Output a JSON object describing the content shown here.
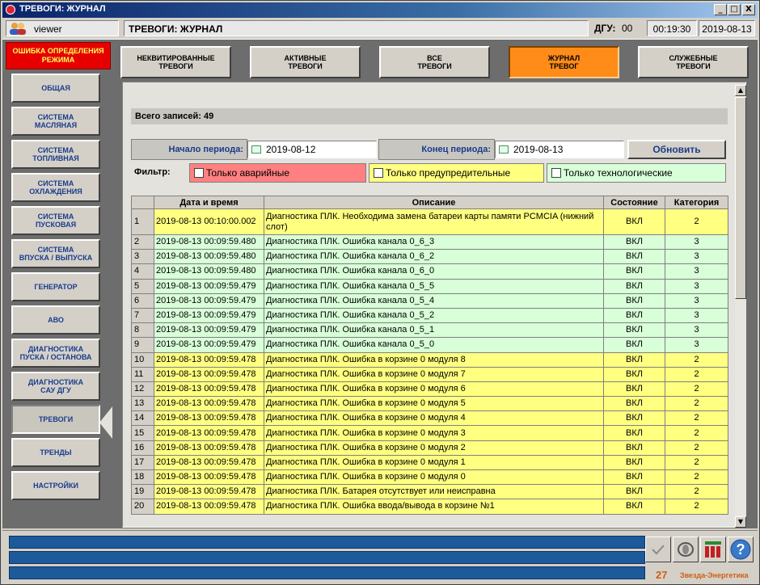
{
  "window": {
    "title": "ТРЕВОГИ: ЖУРНАЛ",
    "min": "_",
    "max": "□",
    "close": "X"
  },
  "infobar": {
    "user": "viewer",
    "screen_title": "ТРЕВОГИ: ЖУРНАЛ",
    "dgu_label": "ДГУ:",
    "dgu_value": "00",
    "time": "00:19:30",
    "date": "2019-08-13"
  },
  "sidebar": {
    "alarm": "ОШИБКА ОПРЕДЕЛЕНИЯ\nРЕЖИМА",
    "items": [
      {
        "label": "ОБЩАЯ"
      },
      {
        "label": "СИСТЕМА\nМАСЛЯНАЯ"
      },
      {
        "label": "СИСТЕМА\nТОПЛИВНАЯ"
      },
      {
        "label": "СИСТЕМА\nОХЛАЖДЕНИЯ"
      },
      {
        "label": "СИСТЕМА\nПУСКОВАЯ"
      },
      {
        "label": "СИСТЕМА\nВПУСКА / ВЫПУСКА"
      },
      {
        "label": "ГЕНЕРАТОР"
      },
      {
        "label": "АВО"
      },
      {
        "label": "ДИАГНОСТИКА\nПУСКА / ОСТАНОВА"
      },
      {
        "label": "ДИАГНОСТИКА\nСАУ ДГУ"
      },
      {
        "label": "ТРЕВОГИ"
      },
      {
        "label": "ТРЕНДЫ"
      },
      {
        "label": "НАСТРОЙКИ"
      }
    ]
  },
  "tabs": [
    {
      "label": "НЕКВИТИРОВАННЫЕ\nТРЕВОГИ"
    },
    {
      "label": "АКТИВНЫЕ\nТРЕВОГИ"
    },
    {
      "label": "ВСЕ\nТРЕВОГИ"
    },
    {
      "label": "ЖУРНАЛ\nТРЕВОГ"
    },
    {
      "label": "СЛУЖЕБНЫЕ\nТРЕВОГИ"
    }
  ],
  "journal": {
    "total": "Всего записей: 49",
    "start_label": "Начало периода:",
    "start_value": "2019-08-12",
    "end_label": "Конец периода:",
    "end_value": "2019-08-13",
    "refresh": "Обновить",
    "filter_label": "Фильтр:",
    "filters": [
      {
        "label": "Только аварийные",
        "color": "#ff8080"
      },
      {
        "label": "Только предупредительные",
        "color": "#ffff80"
      },
      {
        "label": "Только технологические",
        "color": "#d8ffd8"
      }
    ],
    "columns": [
      "",
      "Дата и время",
      "Описание",
      "Состояние",
      "Категория"
    ],
    "rows": [
      {
        "n": "1",
        "dt": "2019-08-13 00:10:00.002",
        "desc": "Диагностика ПЛК. Необходима замена батареи карты памяти PCMCIA (нижний слот)",
        "state": "ВКЛ",
        "cat": "2"
      },
      {
        "n": "2",
        "dt": "2019-08-13 00:09:59.480",
        "desc": "Диагностика ПЛК. Ошибка канала 0_6_3",
        "state": "ВКЛ",
        "cat": "3"
      },
      {
        "n": "3",
        "dt": "2019-08-13 00:09:59.480",
        "desc": "Диагностика ПЛК. Ошибка канала 0_6_2",
        "state": "ВКЛ",
        "cat": "3"
      },
      {
        "n": "4",
        "dt": "2019-08-13 00:09:59.480",
        "desc": "Диагностика ПЛК. Ошибка канала 0_6_0",
        "state": "ВКЛ",
        "cat": "3"
      },
      {
        "n": "5",
        "dt": "2019-08-13 00:09:59.479",
        "desc": "Диагностика ПЛК. Ошибка канала 0_5_5",
        "state": "ВКЛ",
        "cat": "3"
      },
      {
        "n": "6",
        "dt": "2019-08-13 00:09:59.479",
        "desc": "Диагностика ПЛК. Ошибка канала 0_5_4",
        "state": "ВКЛ",
        "cat": "3"
      },
      {
        "n": "7",
        "dt": "2019-08-13 00:09:59.479",
        "desc": "Диагностика ПЛК. Ошибка канала 0_5_2",
        "state": "ВКЛ",
        "cat": "3"
      },
      {
        "n": "8",
        "dt": "2019-08-13 00:09:59.479",
        "desc": "Диагностика ПЛК. Ошибка канала 0_5_1",
        "state": "ВКЛ",
        "cat": "3"
      },
      {
        "n": "9",
        "dt": "2019-08-13 00:09:59.479",
        "desc": "Диагностика ПЛК. Ошибка канала 0_5_0",
        "state": "ВКЛ",
        "cat": "3"
      },
      {
        "n": "10",
        "dt": "2019-08-13 00:09:59.478",
        "desc": "Диагностика ПЛК. Ошибка в корзине 0 модуля 8",
        "state": "ВКЛ",
        "cat": "2"
      },
      {
        "n": "11",
        "dt": "2019-08-13 00:09:59.478",
        "desc": "Диагностика ПЛК. Ошибка в корзине 0 модуля 7",
        "state": "ВКЛ",
        "cat": "2"
      },
      {
        "n": "12",
        "dt": "2019-08-13 00:09:59.478",
        "desc": "Диагностика ПЛК. Ошибка в корзине 0 модуля 6",
        "state": "ВКЛ",
        "cat": "2"
      },
      {
        "n": "13",
        "dt": "2019-08-13 00:09:59.478",
        "desc": "Диагностика ПЛК. Ошибка в корзине 0 модуля 5",
        "state": "ВКЛ",
        "cat": "2"
      },
      {
        "n": "14",
        "dt": "2019-08-13 00:09:59.478",
        "desc": "Диагностика ПЛК. Ошибка в корзине 0 модуля 4",
        "state": "ВКЛ",
        "cat": "2"
      },
      {
        "n": "15",
        "dt": "2019-08-13 00:09:59.478",
        "desc": "Диагностика ПЛК. Ошибка в корзине 0 модуля 3",
        "state": "ВКЛ",
        "cat": "2"
      },
      {
        "n": "16",
        "dt": "2019-08-13 00:09:59.478",
        "desc": "Диагностика ПЛК. Ошибка в корзине 0 модуля 2",
        "state": "ВКЛ",
        "cat": "2"
      },
      {
        "n": "17",
        "dt": "2019-08-13 00:09:59.478",
        "desc": "Диагностика ПЛК. Ошибка в корзине 0 модуля 1",
        "state": "ВКЛ",
        "cat": "2"
      },
      {
        "n": "18",
        "dt": "2019-08-13 00:09:59.478",
        "desc": "Диагностика ПЛК. Ошибка в корзине 0 модуля 0",
        "state": "ВКЛ",
        "cat": "2"
      },
      {
        "n": "19",
        "dt": "2019-08-13 00:09:59.478",
        "desc": "Диагностика ПЛК. Батарея отсутствует или неисправна",
        "state": "ВКЛ",
        "cat": "2"
      },
      {
        "n": "20",
        "dt": "2019-08-13 00:09:59.478",
        "desc": "Диагностика ПЛК. Ошибка ввода/вывода в корзине №1",
        "state": "ВКЛ",
        "cat": "2"
      }
    ]
  },
  "footer": {
    "count": "27",
    "brand": "Звезда-Энергетика"
  },
  "colors": {
    "warning_row": "#ffff80",
    "tech_row": "#d8ffd8",
    "active_tab": "#ff8c19",
    "alarm": "#e60000"
  }
}
